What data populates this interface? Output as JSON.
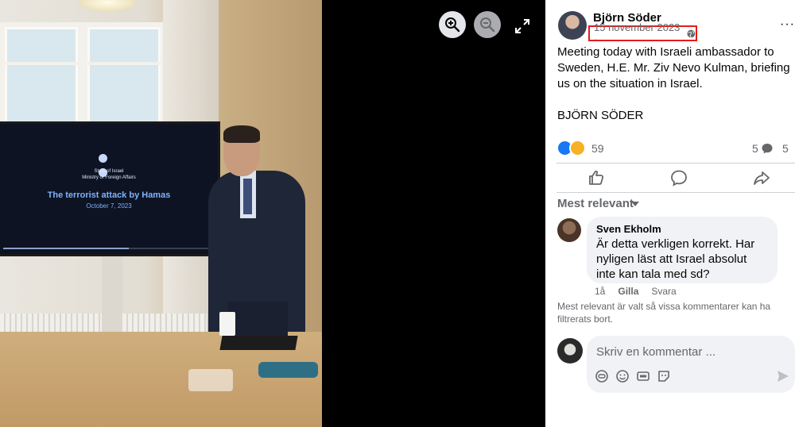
{
  "viewer": {
    "tv_slide": {
      "ministry_line1": "State of Israel",
      "ministry_line2": "Ministry of Foreign Affairs",
      "title": "The terrorist attack by Hamas",
      "date": "October 7, 2023"
    },
    "icons": {
      "zoom_in": "zoom-in-icon",
      "zoom_out": "zoom-out-icon",
      "fullscreen": "fullscreen-icon"
    }
  },
  "post": {
    "author": "Björn Söder",
    "date": "15 november 2023 ·",
    "audience_icon": "globe-icon",
    "more": "···",
    "body": "Meeting today with Israeli ambassador to Sweden, H.E. Mr. Ziv Nevo Kulman, briefing us on the situation in Israel.\n\nBJÖRN SÖDER",
    "reaction_count": "59",
    "comment_count": "5",
    "share_count": "5",
    "highlight_color": "#e41b1b"
  },
  "actions": {
    "like": "like-icon",
    "comment": "comment-icon",
    "share": "share-icon"
  },
  "comments": {
    "sort_label": "Mest relevant",
    "items": [
      {
        "author": "Sven Ekholm",
        "text": "Är detta verkligen korrekt. Har nyligen läst att Israel absolut inte kan tala med sd?",
        "time": "1å",
        "like": "Gilla",
        "reply": "Svara"
      }
    ],
    "filter_note": "Mest relevant är valt så vissa kommentarer kan ha filtrerats bort."
  },
  "composer": {
    "placeholder": "Skriv en kommentar ..."
  },
  "colors": {
    "accent": "#1877f2",
    "secondary_text": "#65676b",
    "bubble": "#f0f2f5"
  }
}
